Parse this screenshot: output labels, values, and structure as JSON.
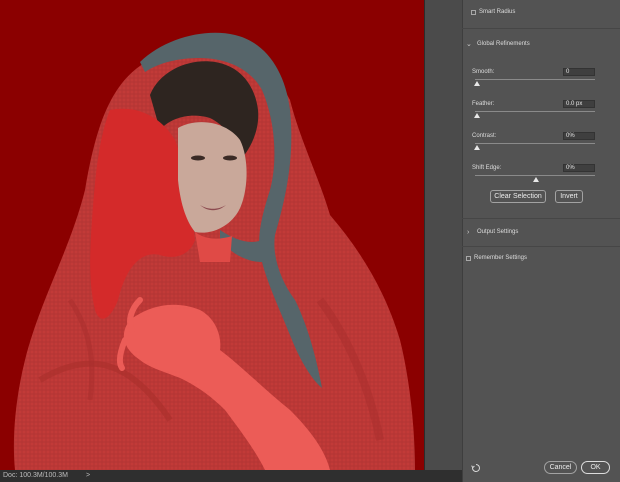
{
  "status_bar": {
    "doc_info": "Doc: 100.3M/100.3M",
    "arrow": ">"
  },
  "panel": {
    "smart_radius": {
      "label": "Smart Radius",
      "checked": false
    },
    "global_refinements": {
      "header": "Global Refinements",
      "expanded": true,
      "smooth": {
        "label": "Smooth:",
        "value": "0",
        "slider": 0.0
      },
      "feather": {
        "label": "Feather:",
        "value": "0.0 px",
        "slider": 0.0
      },
      "contrast": {
        "label": "Contrast:",
        "value": "0%",
        "slider": 0.0
      },
      "shift_edge": {
        "label": "Shift Edge:",
        "value": "0%",
        "slider": 0.5
      },
      "clear_selection_label": "Clear Selection",
      "invert_label": "Invert"
    },
    "output_settings": {
      "header": "Output Settings",
      "expanded": false
    },
    "remember_settings": {
      "label": "Remember Settings",
      "checked": false
    },
    "cancel_label": "Cancel",
    "ok_label": "OK"
  },
  "colors": {
    "overlay_red": "#8b0000",
    "selected_red": "#e85450",
    "panel_bg": "#535353"
  },
  "icons": [
    "checkbox-icon",
    "chevron-down-icon",
    "chevron-right-icon",
    "slider-thumb-icon",
    "reset-icon"
  ]
}
